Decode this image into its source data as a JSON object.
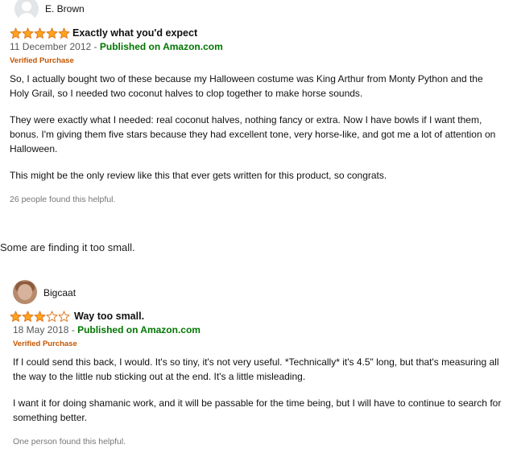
{
  "reviews": [
    {
      "username": "E. Brown",
      "rating": 5,
      "max_rating": 5,
      "title": "Exactly what you'd expect",
      "date": "11 December 2012",
      "date_separator": " - ",
      "published": "Published on Amazon.com",
      "verified": "Verified Purchase",
      "paragraphs": [
        "So, I actually bought two of these because my Halloween costume was King Arthur from Monty Python and the Holy Grail, so I needed two coconut halves to clop together to make horse sounds.",
        "They were exactly what I needed: real coconut halves, nothing fancy or extra. Now I have bowls if I want them, bonus. I'm giving them five stars because they had excellent tone, very horse-like, and got me a lot of attention on Halloween.",
        "This might be the only review like this that ever gets written for this product, so congrats."
      ],
      "helpful": "26 people found this helpful."
    },
    {
      "username": "Bigcaat",
      "rating": 3,
      "max_rating": 5,
      "title": "Way too small.",
      "date": "18 May 2018",
      "date_separator": " - ",
      "published": "Published on Amazon.com",
      "verified": "Verified Purchase",
      "paragraphs": [
        "If I could send this back, I would. It's so tiny, it's not very useful. *Technically* it's 4.5\" long, but that's measuring all the way to the little nub sticking out at the end. It's a little misleading.",
        "I want it for doing shamanic work, and it will be passable for the time being, but I will have to continue to search for something better."
      ],
      "helpful": "One person found this helpful."
    }
  ],
  "between_text": "Some are finding it too small.",
  "colors": {
    "star_fill": "#ffa41c",
    "star_stroke": "#de7921",
    "published": "#007600",
    "verified": "#c45500"
  }
}
